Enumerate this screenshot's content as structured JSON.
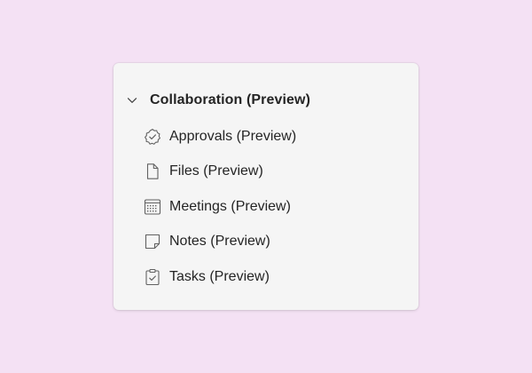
{
  "panel": {
    "group": {
      "title": "Collaboration (Preview)",
      "expanded": true,
      "icon": "chevron-down-icon"
    },
    "items": [
      {
        "label": "Approvals (Preview)",
        "icon": "approvals-icon"
      },
      {
        "label": "Files (Preview)",
        "icon": "file-icon"
      },
      {
        "label": "Meetings (Preview)",
        "icon": "calendar-icon"
      },
      {
        "label": "Notes (Preview)",
        "icon": "note-icon"
      },
      {
        "label": "Tasks (Preview)",
        "icon": "tasks-icon"
      }
    ]
  },
  "colors": {
    "background": "#f4e1f4",
    "panel": "#f5f5f5",
    "text": "#242424",
    "icon": "#616161"
  }
}
